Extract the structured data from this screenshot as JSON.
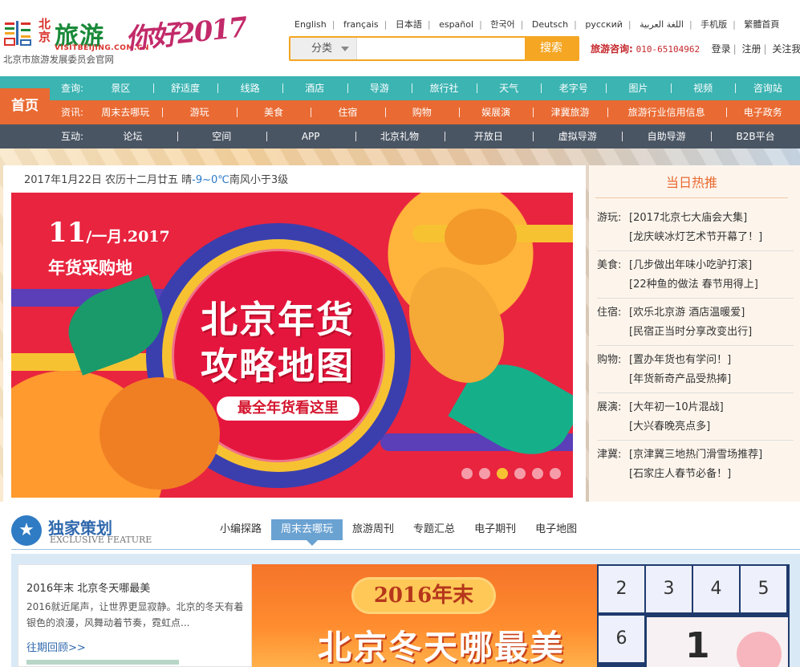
{
  "header": {
    "logo_beijing": "北京",
    "logo_lvyou": "旅游",
    "logo_url": "VISITBEIJING.COM.CN",
    "logo_sub": "北京市旅游发展委员会官网",
    "calligraphy": "你好2017",
    "languages": [
      "English",
      "français",
      "日本語",
      "español",
      "한국어",
      "Deutsch",
      "русский",
      "اللغة العربية",
      "手机版",
      "繁體首頁"
    ],
    "search": {
      "category": "分类",
      "placeholder": "",
      "button": "搜索"
    },
    "hotline_label": "旅游咨询:",
    "hotline_number": "010-65104962",
    "links": [
      "登录",
      "注册",
      "关注我"
    ]
  },
  "nav": {
    "home": "首页",
    "rows": [
      {
        "lead": "查询:",
        "items": [
          "景区",
          "舒适度",
          "线路",
          "酒店",
          "导游",
          "旅行社",
          "天气",
          "老字号",
          "图片",
          "视频",
          "咨询站"
        ]
      },
      {
        "lead": "资讯:",
        "items": [
          "周末去哪玩",
          "游玩",
          "美食",
          "住宿",
          "购物",
          "娱展演",
          "津冀旅游",
          "旅游行业信用信息",
          "电子政务"
        ]
      },
      {
        "lead": "互动:",
        "items": [
          "论坛",
          "空间",
          "APP",
          "北京礼物",
          "开放日",
          "虚拟导游",
          "自助导游",
          "B2B平台"
        ]
      }
    ]
  },
  "date_line": {
    "date": "2017年1月22日 农历十二月廿五 晴",
    "temp": "-9~0℃",
    "wind": "南风小于3级"
  },
  "banner": {
    "date_day": "11",
    "date_rest": "/一月.2017",
    "subtitle": "年货采购地",
    "title1": "北京年货",
    "title2": "攻略地图",
    "ribbon": "最全年货看这里",
    "dots_total": 6,
    "dots_active_index": 2
  },
  "hot": {
    "title": "当日热推",
    "groups": [
      {
        "cat": "游玩:",
        "l1": "[2017北京七大庙会大集]",
        "l2": "[龙庆峡冰灯艺术节开幕了！]"
      },
      {
        "cat": "美食:",
        "l1": "[几步做出年味小吃驴打滚]",
        "l2": "[22种鱼的做法 春节用得上]"
      },
      {
        "cat": "住宿:",
        "l1": "[欢乐北京游 酒店温暖爱]",
        "l2": "[民宿正当时分享改变出行]"
      },
      {
        "cat": "购物:",
        "l1": "[置办年货也有学问！]",
        "l2": "[年货新奇产品受热捧]"
      },
      {
        "cat": "展演:",
        "l1": "[大年初一10片混战]",
        "l2": "[大兴春晚亮点多]"
      },
      {
        "cat": "津冀:",
        "l1": "[京津冀三地热门滑雪场推荐]",
        "l2": "[石家庄人春节必备！]"
      }
    ]
  },
  "exclusive": {
    "title": "独家策划",
    "en": "EXCLUSIVE FEATURE",
    "tabs": [
      "小编探路",
      "周末去哪玩",
      "旅游周刊",
      "专题汇总",
      "电子期刊",
      "电子地图"
    ],
    "active_tab": 1,
    "card": {
      "title": "2016年末 北京冬天哪最美",
      "desc": "2016就近尾声，让世界更显寂静。北京的冬天有着银色的浪漫，风舞动着节奏，霓虹点...",
      "more": "往期回顾>>"
    },
    "image": {
      "pill": "2016年末",
      "big": "北京冬天哪最美"
    },
    "calendar": {
      "cells": [
        "2",
        "3",
        "4",
        "5",
        "6"
      ],
      "big": "1"
    }
  }
}
